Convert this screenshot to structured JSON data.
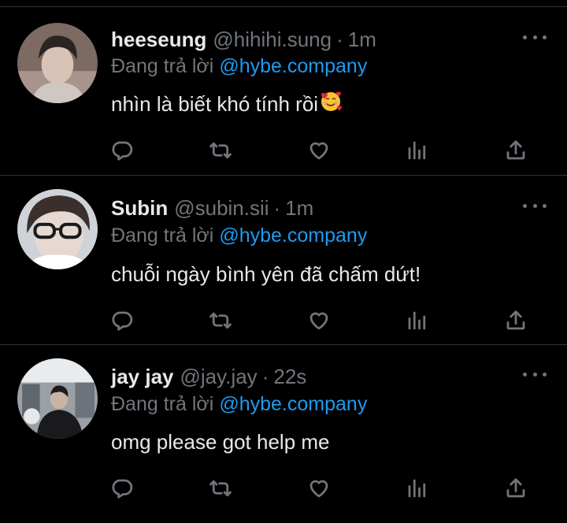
{
  "tweets": [
    {
      "name": "heeseung",
      "handle": "@hihihi.sung",
      "separator": "·",
      "time": "1m",
      "reply_label": "Đang trả lời",
      "reply_to": "@hybe.company",
      "text": "nhìn là biết khó tính rồi",
      "emoji": "smiling-face-with-hearts"
    },
    {
      "name": "Subin",
      "handle": "@subin.sii",
      "separator": "·",
      "time": "1m",
      "reply_label": "Đang trả lời",
      "reply_to": "@hybe.company",
      "text": "chuỗi ngày bình yên đã chấm dứt!"
    },
    {
      "name": "jay jay",
      "handle": "@jay.jay",
      "separator": "·",
      "time": "22s",
      "reply_label": "Đang trả lời",
      "reply_to": "@hybe.company",
      "text": "omg please got help me"
    }
  ],
  "action_icons": [
    "reply-icon",
    "retweet-icon",
    "like-icon",
    "views-icon",
    "share-icon"
  ],
  "colors": {
    "background": "#000000",
    "text": "#e7e9ea",
    "muted": "#71767b",
    "mention": "#1d9bf0",
    "divider": "#2f3336"
  }
}
